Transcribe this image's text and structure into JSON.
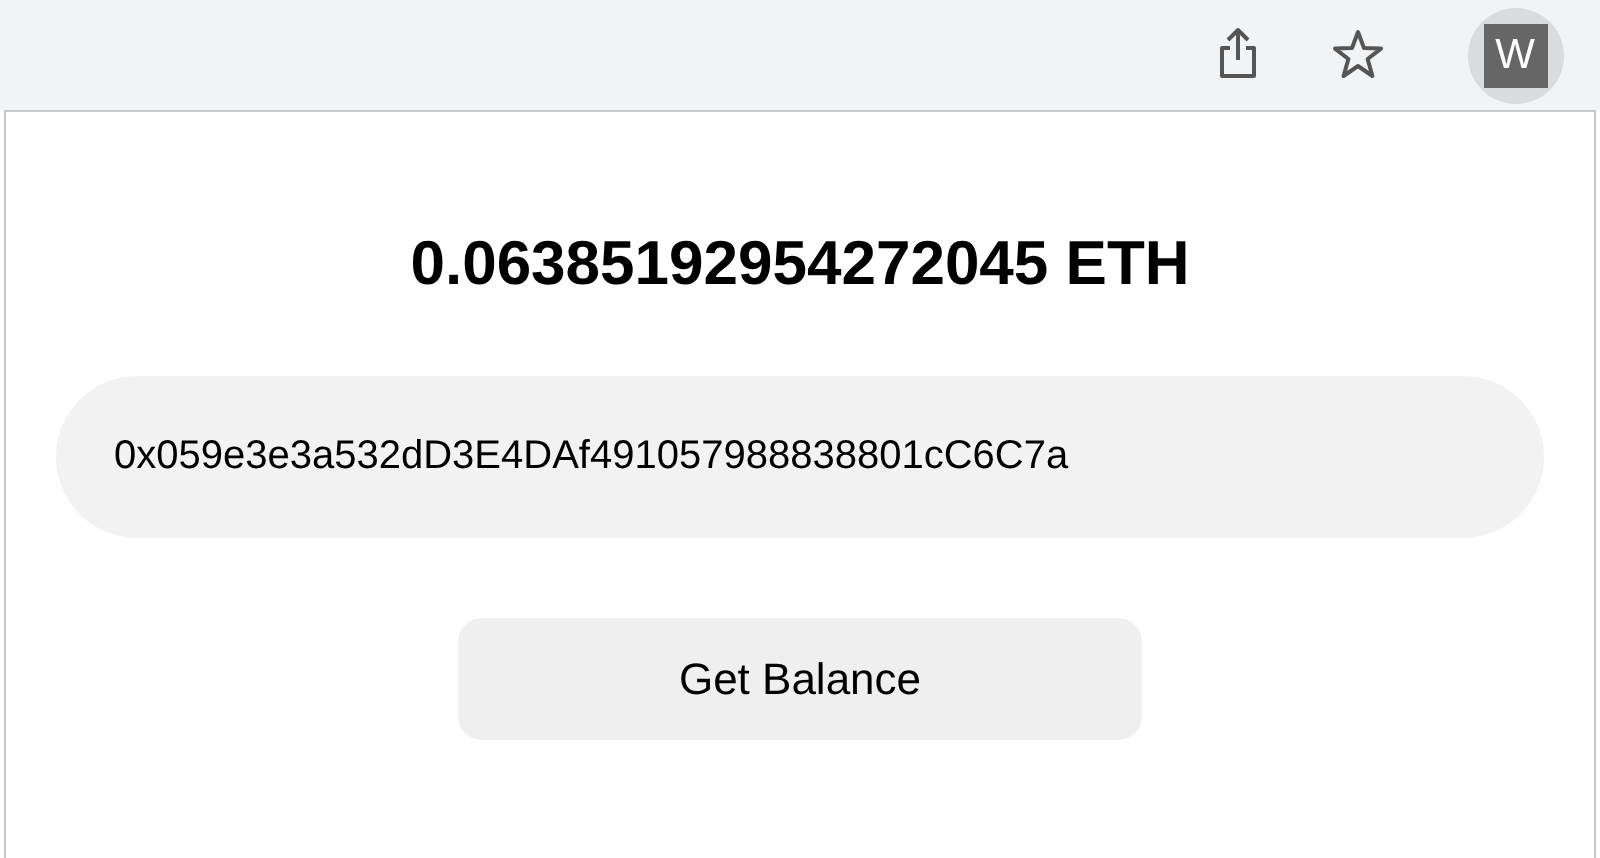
{
  "toolbar": {
    "extension_letter": "W"
  },
  "popup": {
    "balance": "0.06385192954272045 ETH",
    "address_field": {
      "value": "0x059e3e3a532dD3E4DAf491057988838801cC6C7a"
    },
    "button": "Get Balance"
  }
}
